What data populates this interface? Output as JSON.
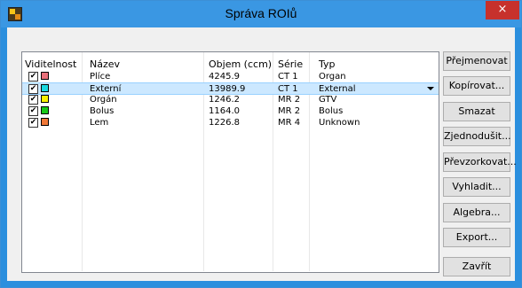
{
  "window": {
    "title": "Správa ROIů",
    "close_label": "×"
  },
  "table": {
    "columns": [
      "Viditelnost",
      "Název",
      "Objem (ccm)",
      "Série",
      "Typ"
    ],
    "rows": [
      {
        "visible": true,
        "color": "#e8707a",
        "name": "Plíce",
        "volume": "4245.9",
        "series": "CT 1",
        "type": "Organ",
        "selected": false
      },
      {
        "visible": true,
        "color": "#18d8e0",
        "name": "Externí",
        "volume": "13989.9",
        "series": "CT 1",
        "type": "External",
        "selected": true
      },
      {
        "visible": true,
        "color": "#f8f000",
        "name": "Orgán",
        "volume": "1246.2",
        "series": "MR 2",
        "type": "GTV",
        "selected": false
      },
      {
        "visible": true,
        "color": "#18c818",
        "name": "Bolus",
        "volume": "1164.0",
        "series": "MR 2",
        "type": "Bolus",
        "selected": false
      },
      {
        "visible": true,
        "color": "#f07838",
        "name": "Lem",
        "volume": "1226.8",
        "series": "MR 4",
        "type": "Unknown",
        "selected": false
      }
    ],
    "check_glyph": "✔"
  },
  "buttons": {
    "rename": "Přejmenovat",
    "copy": "Kopírovat...",
    "delete": "Smazat",
    "simplify": "Zjednodušit...",
    "resample": "Převzorkovat...",
    "smooth": "Vyhladit...",
    "algebra": "Algebra...",
    "export": "Export...",
    "close": "Zavřít"
  }
}
